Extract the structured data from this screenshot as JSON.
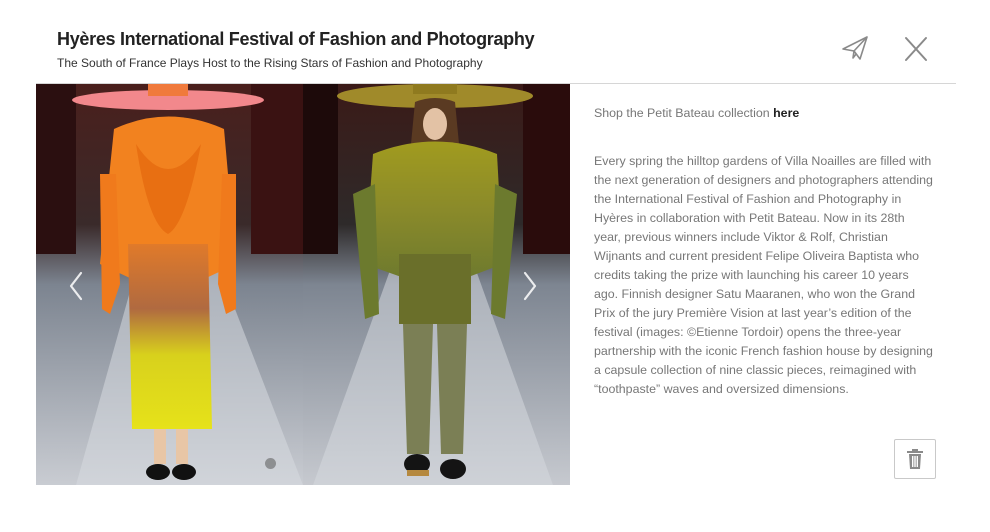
{
  "header": {
    "title": "Hyères International Festival of Fashion and Photography",
    "subtitle": "The South of France Plays Host to the Rising Stars of Fashion and Photography"
  },
  "icons": {
    "share": "paper-plane-icon",
    "close": "close-icon",
    "prev": "chevron-left-icon",
    "next": "chevron-right-icon",
    "delete": "trash-icon"
  },
  "gallery": {
    "photos": [
      {
        "description_icon": "runway-photo-orange-look"
      },
      {
        "description_icon": "runway-photo-olive-look"
      }
    ]
  },
  "aside": {
    "shop_prefix": "Shop the Petit Bateau collection ",
    "shop_link": "here",
    "body": "Every spring the hilltop gardens of Villa Noailles are filled with the next generation of designers and photographers attending the International Festival of Fashion and Photography in Hyères in collaboration with Petit Bateau. Now in its 28th year, previous winners include Viktor & Rolf, Christian Wijnants and current president Felipe Oliveira Baptista who credits taking the prize with launching his career 10 years ago. Finnish designer Satu Maaranen, who won the Grand Prix of the jury Première Vision at last year’s edition of the festival (images: ©Etienne Tordoir) opens the three-year partnership with the iconic French fashion house by designing a capsule collection of nine classic pieces, reimagined with “toothpaste” waves and oversized dimensions."
  },
  "colors": {
    "divider": "#d6d6d6",
    "text_muted": "#777777",
    "text_dark": "#222222",
    "orange_look": "#f07a1c",
    "olive_look": "#8f8a2a"
  }
}
